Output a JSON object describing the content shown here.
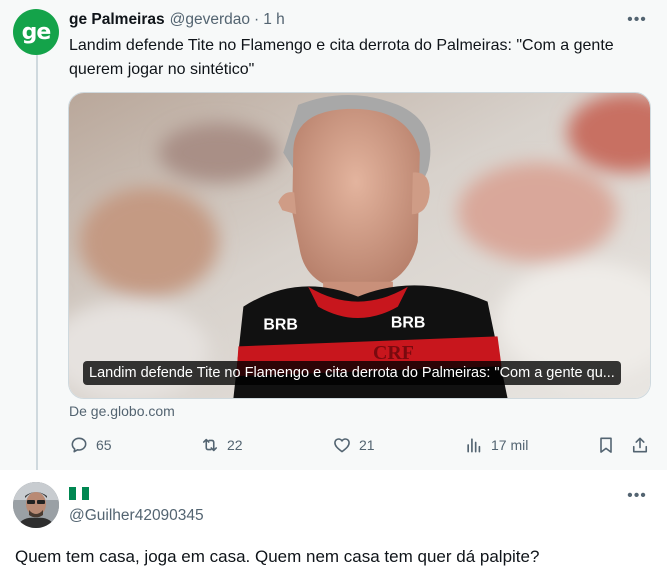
{
  "tweet": {
    "author_name": "ge Palmeiras",
    "handle": "@geverdao",
    "separator": "·",
    "time": "1 h",
    "avatar_text": "ge",
    "text": "Landim defende Tite no Flamengo e cita derrota do Palmeiras: \"Com a gente querem jogar no sintético\"",
    "more_icon": "more-horizontal-icon",
    "card": {
      "title": "Landim defende Tite no Flamengo e cita derrota do Palmeiras: \"Com a gente qu...",
      "source": "De ge.globo.com",
      "jersey_sponsor": "BRB",
      "jersey_crest": "CRF"
    },
    "actions": {
      "replies": "65",
      "retweets": "22",
      "likes": "21",
      "views": "17 mil"
    }
  },
  "reply": {
    "handle": "@Guilher42090345",
    "text": "Quem tem casa, joga em casa. Quem nem casa tem quer dá palpite?",
    "flag_colors": [
      "#008751",
      "#ffffff",
      "#008751"
    ]
  },
  "colors": {
    "ge_green": "#14a34a",
    "secondary_text": "#536471",
    "primary_text": "#0f1419",
    "jersey_red": "#c8161d",
    "jersey_black": "#111111"
  }
}
